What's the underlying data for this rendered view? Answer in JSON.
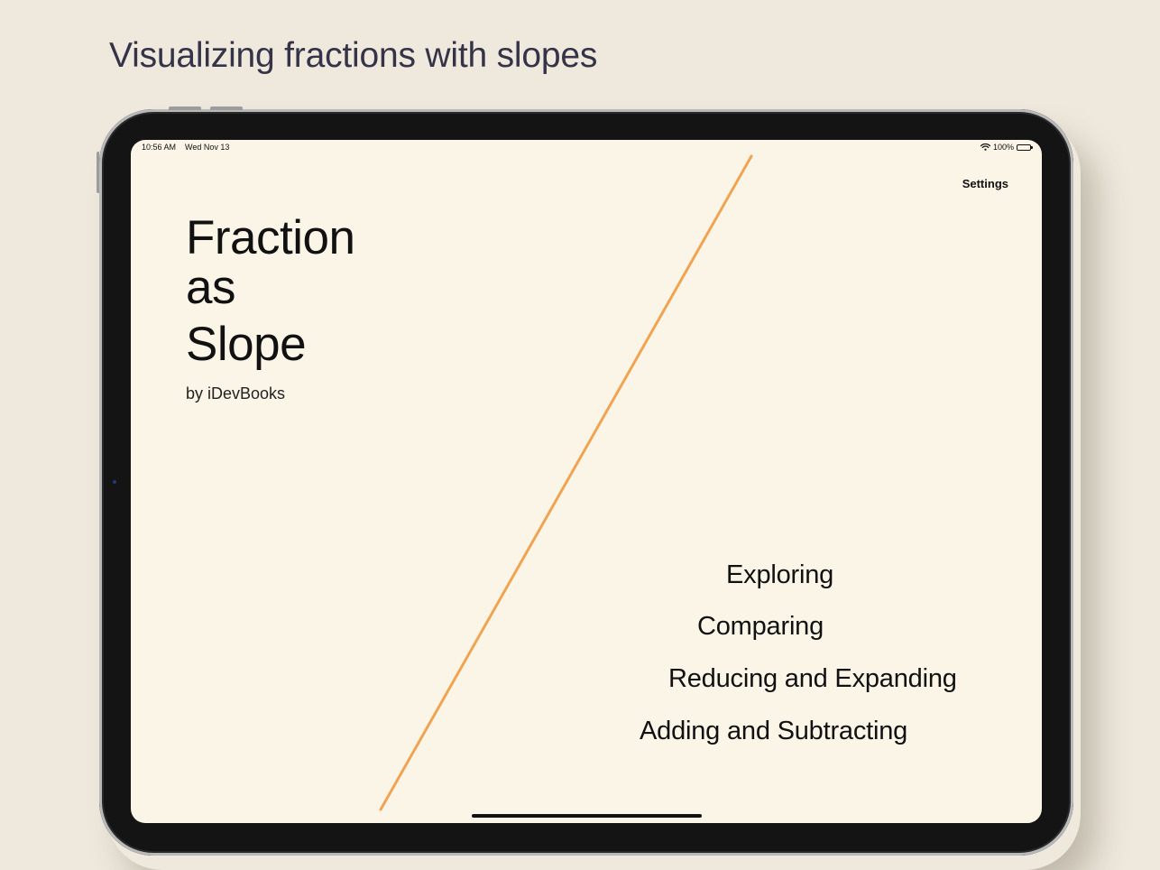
{
  "caption": {
    "text": "Visualizing fractions with slopes"
  },
  "status_bar": {
    "time": "10:56 AM",
    "date": "Wed Nov 13",
    "battery": "100%"
  },
  "app": {
    "settings_label": "Settings",
    "title_lines": [
      "Fraction",
      "as",
      "Slope"
    ],
    "byline": "by iDevBooks",
    "menu": [
      {
        "label": "Exploring"
      },
      {
        "label": "Comparing"
      },
      {
        "label": "Reducing and Expanding"
      },
      {
        "label": "Adding and Subtracting"
      }
    ]
  },
  "colors": {
    "background": "#efe9dd",
    "screen": "#fbf5e8",
    "slope_line": "#f0a451",
    "caption_text": "#353347",
    "device_frame": "#141414"
  },
  "icons": {
    "wifi": "wifi-icon",
    "battery": "battery-icon"
  }
}
